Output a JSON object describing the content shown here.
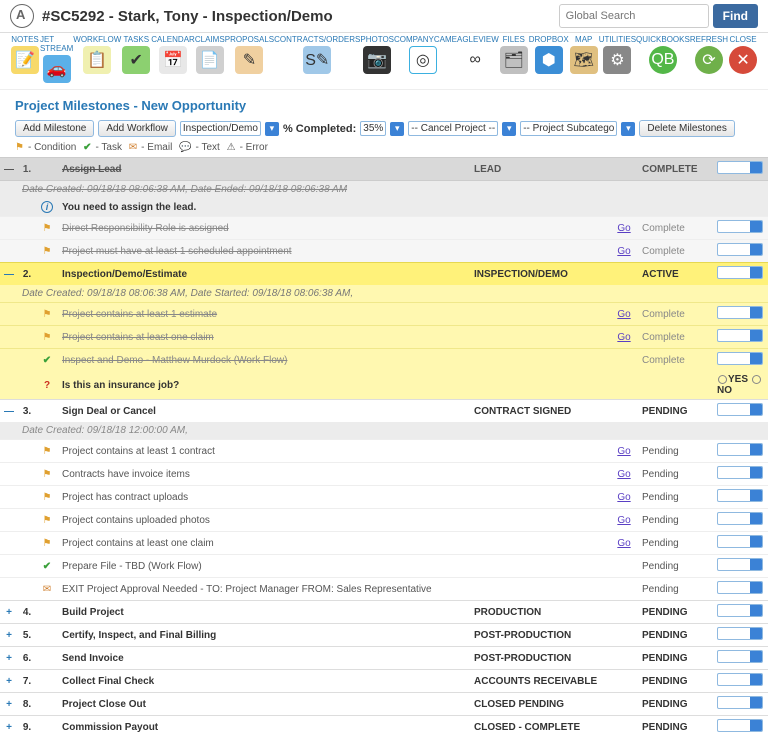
{
  "header": {
    "title": "#SC5292 - Stark, Tony - Inspection/Demo",
    "search_ph": "Global Search",
    "find": "Find"
  },
  "tools": [
    {
      "label": "NOTES",
      "icon": "📝",
      "bg": "#f7d96a"
    },
    {
      "label": "JET STREAM",
      "icon": "🚗",
      "bg": "#5bb0e8"
    },
    {
      "label": "WORKFLOW",
      "icon": "📋",
      "bg": "#f0f0b0"
    },
    {
      "label": "TASKS",
      "icon": "✔",
      "bg": "#8cd070"
    },
    {
      "label": "CALENDAR",
      "icon": "📅",
      "bg": "#e8e8e8"
    },
    {
      "label": "CLAIMS",
      "icon": "📄",
      "bg": "#d0d0d0"
    },
    {
      "label": "PROPOSALS",
      "icon": "✎",
      "bg": "#f0d0a0"
    },
    {
      "label": "CONTRACTS/ORDERS",
      "icon": "S✎",
      "bg": "#a0c8e8"
    },
    {
      "label": "PHOTOS",
      "icon": "📷",
      "bg": "#333"
    },
    {
      "label": "COMPANYCAM",
      "icon": "◎",
      "bg": "#fff"
    },
    {
      "label": "EAGLEVIEW",
      "icon": "∞",
      "bg": "#fff"
    },
    {
      "label": "FILES",
      "icon": "🗂",
      "bg": "#c0c0c0"
    },
    {
      "label": "DROPBOX",
      "icon": "⬢",
      "bg": "#3b8ed6"
    },
    {
      "label": "MAP",
      "icon": "🗺",
      "bg": "#e0c080"
    },
    {
      "label": "UTILITIES",
      "icon": "⚙",
      "bg": "#888"
    },
    {
      "label": "QUICKBOOKS",
      "icon": "qb",
      "bg": "#53b748"
    },
    {
      "label": "REFRESH",
      "icon": "⟳",
      "bg": "#6fb04a"
    },
    {
      "label": "CLOSE",
      "icon": "✕",
      "bg": "#d64a3a"
    }
  ],
  "section": "Project Milestones - New Opportunity",
  "ctrl": {
    "add_ms": "Add Milestone",
    "add_wf": "Add Workflow",
    "stage": "Inspection/Demo",
    "pct_lbl": "% Completed:",
    "pct": "35%",
    "cancel": "-- Cancel Project --",
    "subcat": "-- Project Subcatego",
    "del": "Delete Milestones"
  },
  "legend": {
    "cond": "- Condition",
    "task": "- Task",
    "email": "- Email",
    "text": "- Text",
    "error": "- Error"
  },
  "go": "Go",
  "yes": "YES",
  "no": "NO",
  "ms": [
    {
      "n": "1.",
      "title": "Assign Lead",
      "col": "LEAD",
      "status": "COMPLETE",
      "type": "hdr",
      "strike": true,
      "sub": "Date Created: 09/18/18 08:06:38 AM, Date Ended: 09/18/18 08:06:38 AM",
      "info": "You need to assign the lead.",
      "rows": [
        {
          "ic": "flag",
          "t": "Direct Responsibility Role is assigned",
          "go": true,
          "st": "Complete",
          "strike": true
        },
        {
          "ic": "flag",
          "t": "Project must have at least 1 scheduled appointment",
          "go": true,
          "st": "Complete",
          "strike": true
        }
      ]
    },
    {
      "n": "2.",
      "title": "Inspection/Demo/Estimate",
      "col": "INSPECTION/DEMO",
      "status": "ACTIVE",
      "type": "yhdr",
      "sub": "Date Created: 09/18/18 08:06:38 AM, Date Started: 09/18/18 08:06:38 AM,",
      "rows": [
        {
          "ic": "flag",
          "t": "Project contains at least 1 estimate",
          "go": true,
          "st": "Complete",
          "strike": true
        },
        {
          "ic": "flag",
          "t": "Project contains at least one claim",
          "go": true,
          "st": "Complete",
          "strike": true
        },
        {
          "ic": "check",
          "t": "Inspect and Demo - Matthew Murdock (Work Flow)",
          "go": false,
          "st": "Complete",
          "strike": true
        },
        {
          "ic": "q",
          "t": "Is this an insurance job?",
          "go": false,
          "st": "",
          "yn": true
        }
      ]
    },
    {
      "n": "3.",
      "title": "Sign Deal or Cancel",
      "col": "CONTRACT SIGNED",
      "status": "PENDING",
      "type": "whdr",
      "sub": "Date Created: 09/18/18 12:00:00 AM,",
      "rows": [
        {
          "ic": "flag",
          "t": "Project contains at least 1 contract",
          "go": true,
          "st": "Pending"
        },
        {
          "ic": "flag",
          "t": "Contracts have invoice items",
          "go": true,
          "st": "Pending"
        },
        {
          "ic": "flag",
          "t": "Project has contract uploads",
          "go": true,
          "st": "Pending"
        },
        {
          "ic": "flag",
          "t": "Project contains uploaded photos",
          "go": true,
          "st": "Pending"
        },
        {
          "ic": "flag",
          "t": "Project contains at least one claim",
          "go": true,
          "st": "Pending"
        },
        {
          "ic": "check",
          "t": "Prepare File - TBD (Work Flow)",
          "go": false,
          "st": "Pending"
        },
        {
          "ic": "mail",
          "t": "EXIT Project Approval Needed - TO: Project Manager FROM: Sales Representative",
          "go": false,
          "st": "Pending"
        }
      ]
    },
    {
      "n": "4.",
      "title": "Build Project",
      "col": "PRODUCTION",
      "status": "PENDING",
      "type": "plus"
    },
    {
      "n": "5.",
      "title": "Certify, Inspect, and Final Billing",
      "col": "POST-PRODUCTION",
      "status": "PENDING",
      "type": "plus"
    },
    {
      "n": "6.",
      "title": "Send Invoice",
      "col": "POST-PRODUCTION",
      "status": "PENDING",
      "type": "plus"
    },
    {
      "n": "7.",
      "title": "Collect Final Check",
      "col": "ACCOUNTS RECEIVABLE",
      "status": "PENDING",
      "type": "plus"
    },
    {
      "n": "8.",
      "title": "Project Close Out",
      "col": "CLOSED PENDING",
      "status": "PENDING",
      "type": "plus"
    },
    {
      "n": "9.",
      "title": "Commission Payout",
      "col": "CLOSED - COMPLETE",
      "status": "PENDING",
      "type": "plus"
    }
  ]
}
